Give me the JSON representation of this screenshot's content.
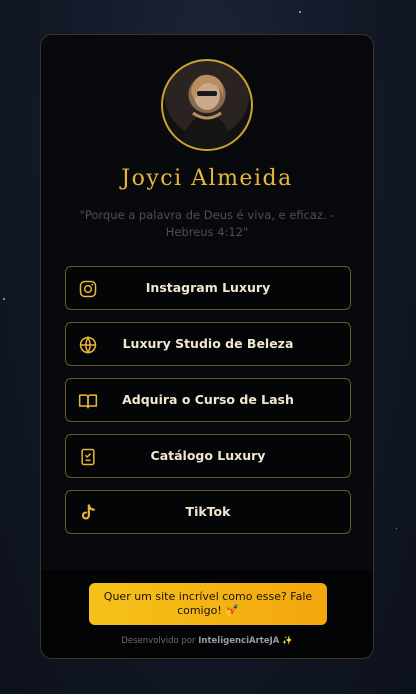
{
  "profile": {
    "name": "Joyci Almeida",
    "quote": "\"Porque a palavra de Deus é viva, e eficaz. - Hebreus 4:12\""
  },
  "links": [
    {
      "label": "Instagram Luxury",
      "icon": "instagram-icon"
    },
    {
      "label": "Luxury Studio de Beleza",
      "icon": "globe-icon"
    },
    {
      "label": "Adquira o Curso de Lash",
      "icon": "book-icon"
    },
    {
      "label": "Catálogo Luxury",
      "icon": "catalog-icon"
    },
    {
      "label": "TikTok",
      "icon": "tiktok-icon"
    }
  ],
  "footer": {
    "cta_line1": "Quer um site incrível como esse? Fale",
    "cta_line2": "comigo! 💅",
    "credit_prefix": "Desenvolvido por ",
    "credit_brand": "InteligenciArteJA",
    "credit_suffix": " ✨"
  },
  "colors": {
    "accent": "#e7b73a",
    "border": "#6b5a22",
    "cta_start": "#f5c21a",
    "cta_end": "#f4a70d"
  }
}
